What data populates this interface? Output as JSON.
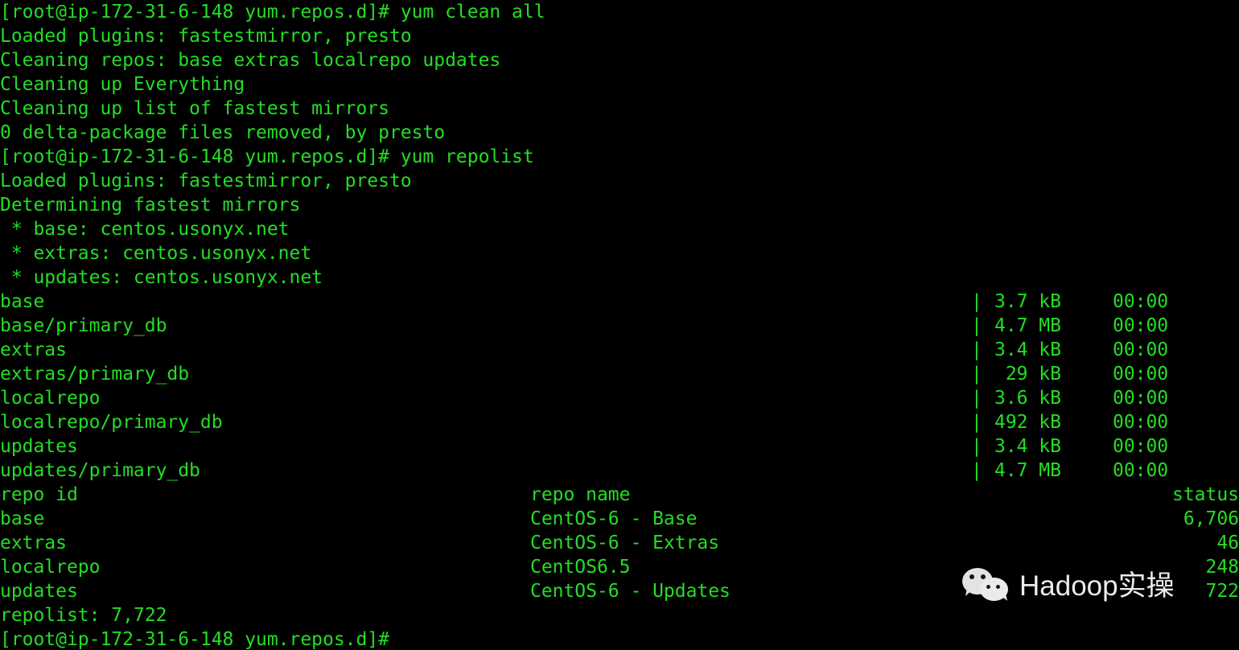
{
  "terminal": {
    "prompt": "[root@ip-172-31-6-148 yum.repos.d]#",
    "foreground_color": "#24dd24",
    "background_color": "#000000",
    "commands": {
      "clean": "yum clean all",
      "repolist": "yum repolist"
    },
    "lines": {
      "l1_prompt_clean": "[root@ip-172-31-6-148 yum.repos.d]# yum clean all",
      "l2_loaded_plugins": "Loaded plugins: fastestmirror, presto",
      "l3_cleaning_repos": "Cleaning repos: base extras localrepo updates",
      "l4_cleaning_everything": "Cleaning up Everything",
      "l5_cleaning_mirrors": "Cleaning up list of fastest mirrors",
      "l6_delta": "0 delta-package files removed, by presto",
      "l7_prompt_repolist": "[root@ip-172-31-6-148 yum.repos.d]# yum repolist",
      "l8_loaded_plugins": "Loaded plugins: fastestmirror, presto",
      "l9_determining": "Determining fastest mirrors",
      "l10_mirror_base": " * base: centos.usonyx.net",
      "l11_mirror_extras": " * extras: centos.usonyx.net",
      "l12_mirror_updates": " * updates: centos.usonyx.net",
      "l_repolist_total": "repolist: 7,722",
      "l_final_prompt": "[root@ip-172-31-6-148 yum.repos.d]#"
    },
    "metadata_downloads": [
      {
        "name": "base",
        "pipe": "|",
        "size": "3.7 kB",
        "time": "00:00"
      },
      {
        "name": "base/primary_db",
        "pipe": "|",
        "size": "4.7 MB",
        "time": "00:00"
      },
      {
        "name": "extras",
        "pipe": "|",
        "size": "3.4 kB",
        "time": "00:00"
      },
      {
        "name": "extras/primary_db",
        "pipe": "|",
        "size": " 29 kB",
        "time": "00:00"
      },
      {
        "name": "localrepo",
        "pipe": "|",
        "size": "3.6 kB",
        "time": "00:00"
      },
      {
        "name": "localrepo/primary_db",
        "pipe": "|",
        "size": "492 kB",
        "time": "00:00"
      },
      {
        "name": "updates",
        "pipe": "|",
        "size": "3.4 kB",
        "time": "00:00"
      },
      {
        "name": "updates/primary_db",
        "pipe": "|",
        "size": "4.7 MB",
        "time": "00:00"
      }
    ],
    "repo_table": {
      "headers": {
        "repo_id": "repo id",
        "repo_name": "repo name",
        "status": "status"
      },
      "rows": [
        {
          "repo_id": "base",
          "repo_name": "CentOS-6 - Base",
          "status": "6,706"
        },
        {
          "repo_id": "extras",
          "repo_name": "CentOS-6 - Extras",
          "status": "46"
        },
        {
          "repo_id": "localrepo",
          "repo_name": "CentOS6.5",
          "status": "248"
        },
        {
          "repo_id": "updates",
          "repo_name": "CentOS-6 - Updates",
          "status": "722"
        }
      ]
    }
  },
  "watermark": {
    "text": "Hadoop实操",
    "icon": "wechat-logo",
    "color": "#ebebeb"
  }
}
